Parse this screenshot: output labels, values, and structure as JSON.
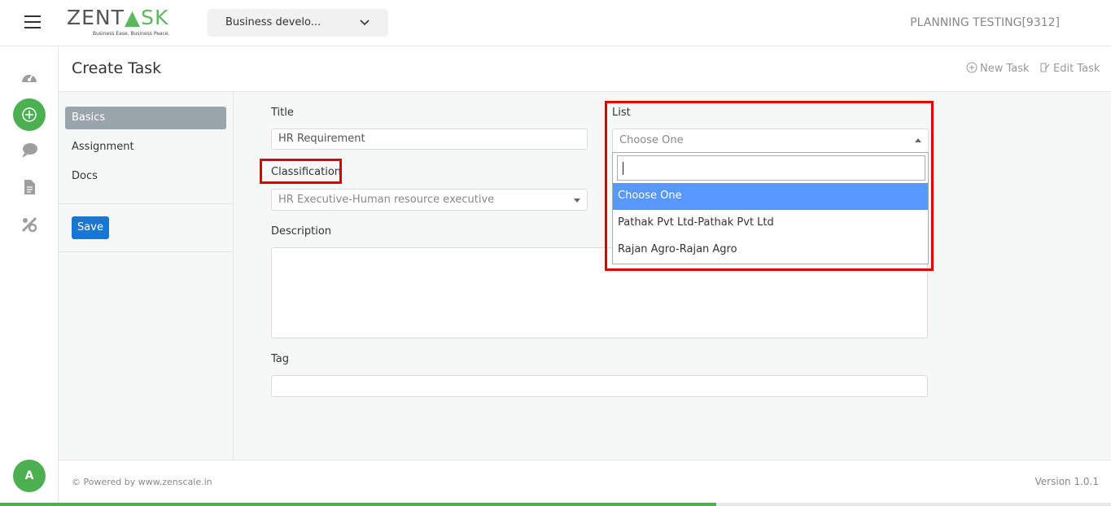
{
  "topbar": {
    "logo_main": "ZENT",
    "logo_accent": "SK",
    "logo_tagline": "Business Ease. Business Peace.",
    "project": "Business develo...",
    "org_name": "PLANNING TESTING[9312]"
  },
  "rail": {
    "avatar_initial": "A"
  },
  "header": {
    "title": "Create Task",
    "new_task": "New Task",
    "edit_task": "Edit Task"
  },
  "tabs": {
    "basics": "Basics",
    "assignment": "Assignment",
    "docs": "Docs",
    "save": "Save"
  },
  "form": {
    "title_label": "Title",
    "title_value": "HR Requirement",
    "classification_label": "Classification",
    "classification_value": "HR Executive-Human resource executive",
    "list_label": "List",
    "list_value": "Choose One",
    "description_label": "Description",
    "description_value": "",
    "tag_label": "Tag",
    "tag_value": ""
  },
  "list_dropdown": {
    "search_value": "",
    "options": [
      "Choose One",
      "Pathak Pvt Ltd-Pathak Pvt Ltd",
      "Rajan Agro-Rajan Agro"
    ],
    "selected_index": 0
  },
  "footer": {
    "powered_by": "Powered by www.zenscale.in",
    "version": "Version 1.0.1"
  },
  "page_load_progress": 0.645,
  "colors": {
    "accent_green": "#4caf50",
    "primary_blue": "#1976d2",
    "highlight_red": "#e00000",
    "option_selected": "#5897fb"
  }
}
